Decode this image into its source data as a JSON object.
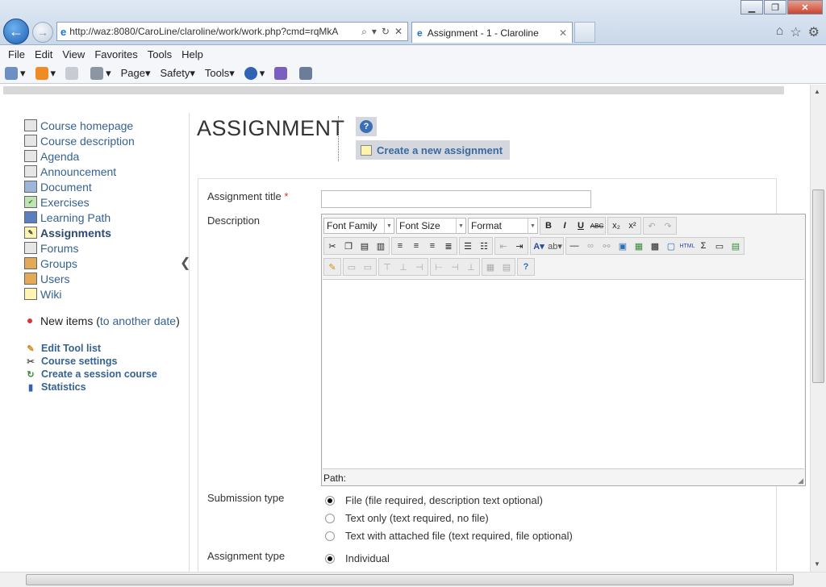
{
  "browser": {
    "url": "http://waz:8080/CaroLine/claroline/work/work.php?cmd=rqMkA",
    "tab_title": "Assignment - 1 - Claroline",
    "tab_close": "✕",
    "menus": [
      "File",
      "Edit",
      "View",
      "Favorites",
      "Tools",
      "Help"
    ],
    "commands": [
      "Page",
      "Safety",
      "Tools"
    ]
  },
  "sidebar": {
    "items": [
      {
        "label": "Course homepage",
        "icon": "book-icon"
      },
      {
        "label": "Course description",
        "icon": "info-book-icon"
      },
      {
        "label": "Agenda",
        "icon": "calendar-icon"
      },
      {
        "label": "Announcement",
        "icon": "announcement-icon"
      },
      {
        "label": "Document",
        "icon": "folder-icon"
      },
      {
        "label": "Exercises",
        "icon": "checkmark-icon"
      },
      {
        "label": "Learning Path",
        "icon": "path-icon"
      },
      {
        "label": "Assignments",
        "icon": "pencil-note-icon",
        "active": true
      },
      {
        "label": "Forums",
        "icon": "forum-icon"
      },
      {
        "label": "Groups",
        "icon": "group-icon"
      },
      {
        "label": "Users",
        "icon": "user-icon"
      },
      {
        "label": "Wiki",
        "icon": "wiki-icon"
      }
    ],
    "new_items_label": "New items (",
    "new_items_link": "to another date",
    "new_items_close": ")",
    "tools": [
      {
        "label": "Edit Tool list",
        "icon": "pencil-icon"
      },
      {
        "label": "Course settings",
        "icon": "wrench-icon"
      },
      {
        "label": "Create a session course",
        "icon": "session-icon"
      },
      {
        "label": "Statistics",
        "icon": "bar-chart-icon"
      }
    ]
  },
  "main": {
    "heading": "ASSIGNMENT",
    "create_label": "Create a new assignment",
    "form": {
      "title_label": "Assignment title",
      "required_mark": "*",
      "description_label": "Description",
      "editor": {
        "font_family": "Font Family",
        "font_size": "Font Size",
        "format": "Format",
        "path_label": "Path:"
      },
      "submission_label": "Submission type",
      "submission_options": [
        {
          "label": "File (file required, description text optional)",
          "selected": true
        },
        {
          "label": "Text only (text required, no file)",
          "selected": false
        },
        {
          "label": "Text with attached file (text required, file optional)",
          "selected": false
        }
      ],
      "assignment_type_label": "Assignment type",
      "assignment_type_options": [
        {
          "label": "Individual",
          "selected": true
        }
      ]
    }
  }
}
